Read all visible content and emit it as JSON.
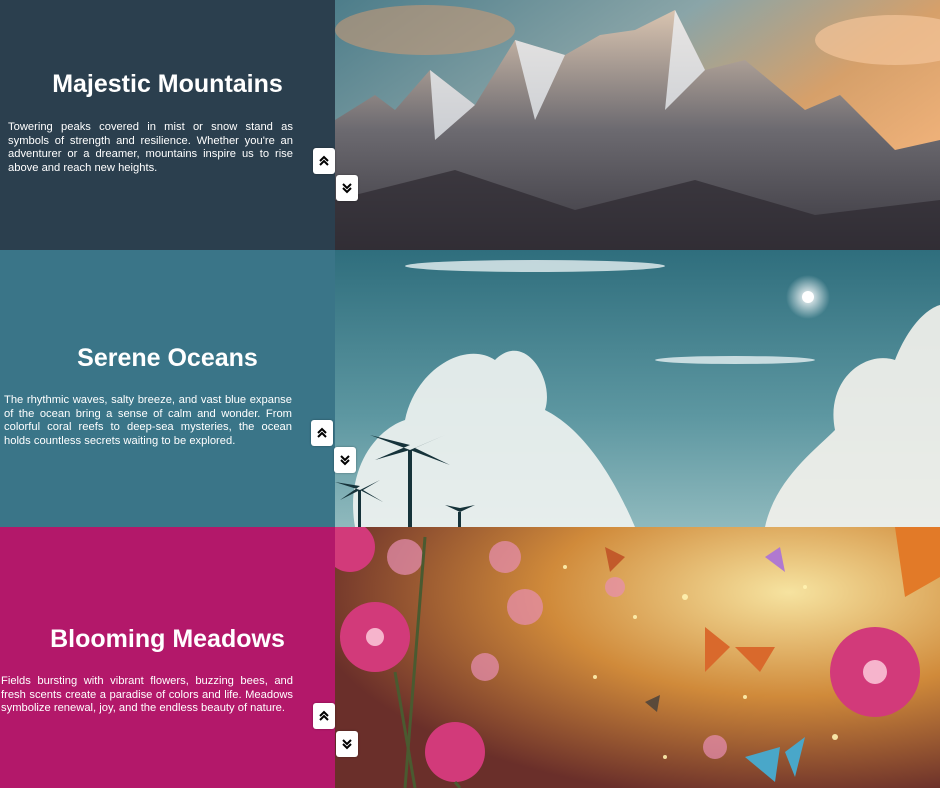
{
  "sections": [
    {
      "title": "Majestic Mountains",
      "text": "Towering peaks covered in mist or snow stand as symbols of strength and resilience. Whether you're an adventurer or a dreamer, mountains inspire us to rise above and reach new heights.",
      "panel_color": "#2b3f4e",
      "image_icon": "mountain-landscape-image"
    },
    {
      "title": "Serene Oceans",
      "text": "The rhythmic waves, salty breeze, and vast blue expanse of the ocean bring a sense of calm and wonder. From colorful coral reefs to deep-sea mysteries, the ocean holds countless secrets waiting to be explored.",
      "panel_color": "#3a7588",
      "image_icon": "ocean-sky-image"
    },
    {
      "title": "Blooming Meadows",
      "text": "Fields bursting with vibrant flowers, buzzing bees, and fresh scents create a paradise of colors and life. Meadows symbolize renewal, joy, and the endless beauty of nature.",
      "panel_color": "#b3186a",
      "image_icon": "meadow-flowers-image"
    }
  ],
  "controls": {
    "up_icon": "chevrons-up-icon",
    "down_icon": "chevrons-down-icon"
  }
}
